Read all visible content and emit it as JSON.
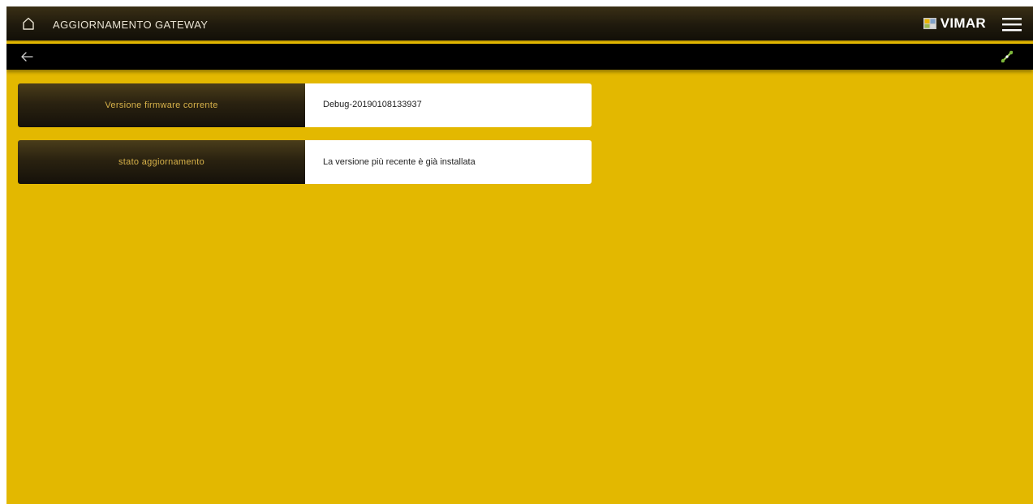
{
  "header": {
    "title": "AGGIORNAMENTO GATEWAY",
    "brand": "VIMAR",
    "icons": [
      "home-icon",
      "vimar-logo",
      "hamburger-menu-icon"
    ]
  },
  "subbar": {
    "icons": [
      "back-arrow-icon",
      "connection-status-icon"
    ]
  },
  "rows": [
    {
      "label": "Versione firmware corrente",
      "value": "Debug-20190108133937"
    },
    {
      "label": "stato aggiornamento",
      "value": "La versione più recente è già installata"
    }
  ],
  "colors": {
    "background": "#e3b800",
    "header_dark": "#1f1a0d",
    "label_text": "#d8b24a",
    "accent_line": "#c9a100"
  }
}
